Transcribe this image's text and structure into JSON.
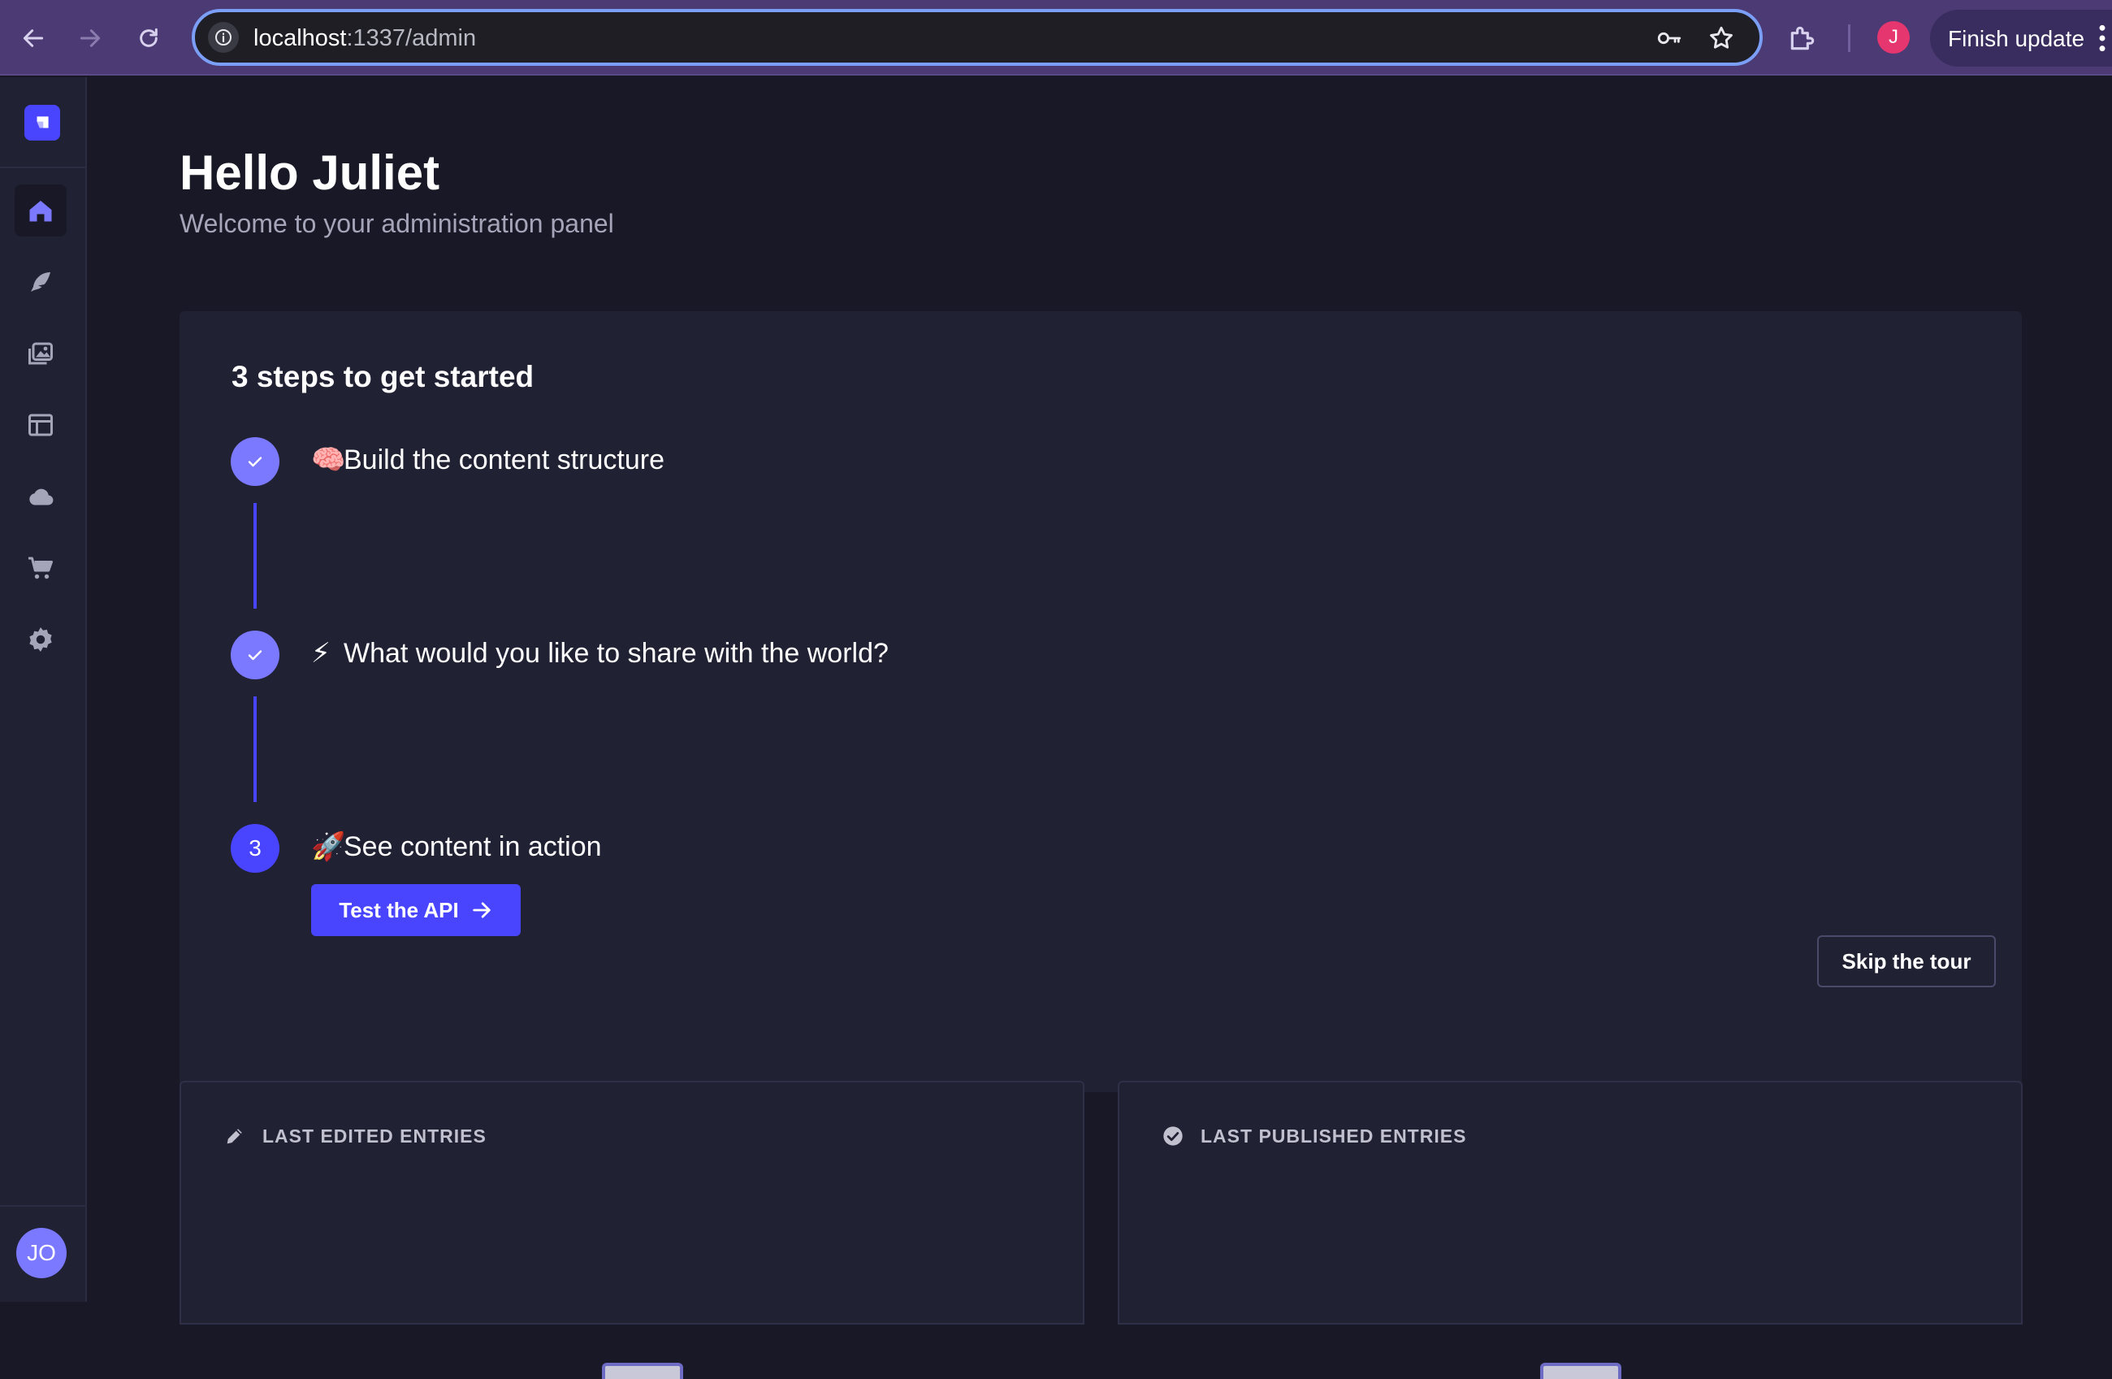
{
  "browser": {
    "url_host": "localhost",
    "url_path": ":1337/admin",
    "profile_initial": "J",
    "finish_update_label": "Finish update"
  },
  "sidebar": {
    "items": [
      {
        "name": "home",
        "icon": "home-icon",
        "active": true
      },
      {
        "name": "content-manager",
        "icon": "feather-icon",
        "active": false
      },
      {
        "name": "media-library",
        "icon": "images-icon",
        "active": false
      },
      {
        "name": "content-type-builder",
        "icon": "layout-icon",
        "active": false
      },
      {
        "name": "cloud",
        "icon": "cloud-icon",
        "active": false
      },
      {
        "name": "marketplace",
        "icon": "cart-icon",
        "active": false
      },
      {
        "name": "settings",
        "icon": "gear-icon",
        "active": false
      }
    ],
    "user_initials": "JO"
  },
  "header": {
    "title": "Hello Juliet",
    "subtitle": "Welcome to your administration panel"
  },
  "guided_tour": {
    "title": "3 steps to get started",
    "steps": [
      {
        "status": "done",
        "emoji": "🧠",
        "label": "Build the content structure"
      },
      {
        "status": "done",
        "emoji": "⚡",
        "label": "What would you like to share with the world?"
      },
      {
        "status": "current",
        "number": "3",
        "emoji": "🚀",
        "label": "See content in action"
      }
    ],
    "cta_label": "Test the API",
    "skip_label": "Skip the tour"
  },
  "widgets": {
    "last_edited": {
      "title": "LAST EDITED ENTRIES",
      "icon": "pencil-icon"
    },
    "last_published": {
      "title": "LAST PUBLISHED ENTRIES",
      "icon": "check-circle-icon"
    }
  },
  "colors": {
    "primary": "#4945ff",
    "primary_light": "#7b79ff",
    "panel": "#212134",
    "background": "#181826",
    "chrome": "#4b3a73"
  }
}
